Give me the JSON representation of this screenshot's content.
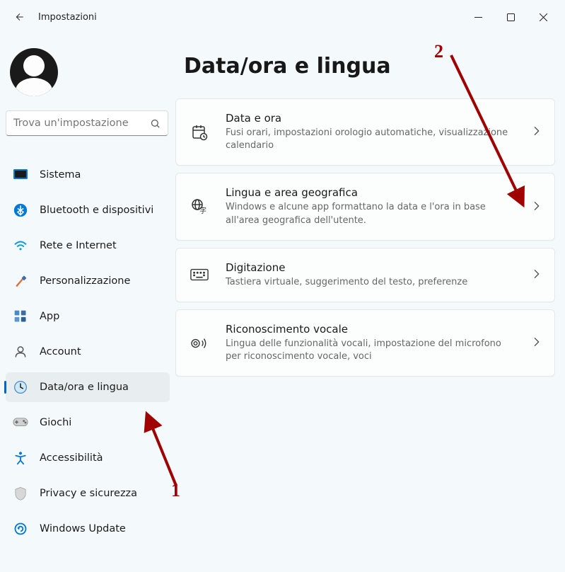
{
  "window": {
    "title": "Impostazioni"
  },
  "search": {
    "placeholder": "Trova un'impostazione"
  },
  "sidebar": {
    "items": [
      {
        "label": "Sistema",
        "icon": "system"
      },
      {
        "label": "Bluetooth e dispositivi",
        "icon": "bluetooth"
      },
      {
        "label": "Rete e Internet",
        "icon": "wifi"
      },
      {
        "label": "Personalizzazione",
        "icon": "brush"
      },
      {
        "label": "App",
        "icon": "apps"
      },
      {
        "label": "Account",
        "icon": "account"
      },
      {
        "label": "Data/ora e lingua",
        "icon": "clock"
      },
      {
        "label": "Giochi",
        "icon": "games"
      },
      {
        "label": "Accessibilità",
        "icon": "accessibility"
      },
      {
        "label": "Privacy e sicurezza",
        "icon": "privacy"
      },
      {
        "label": "Windows Update",
        "icon": "update"
      }
    ],
    "activeIndex": 6
  },
  "page": {
    "title": "Data/ora e lingua"
  },
  "cards": [
    {
      "title": "Data e ora",
      "desc": "Fusi orari, impostazioni orologio automatiche, visualizzazione calendario",
      "icon": "calendar"
    },
    {
      "title": "Lingua e area geografica",
      "desc": "Windows e alcune app formattano la data e l'ora in base all'area geografica dell'utente.",
      "icon": "language"
    },
    {
      "title": "Digitazione",
      "desc": "Tastiera virtuale, suggerimento del testo, preferenze",
      "icon": "keyboard"
    },
    {
      "title": "Riconoscimento vocale",
      "desc": "Lingua delle funzionalità vocali, impostazione del microfono per riconoscimento vocale, voci",
      "icon": "speech"
    }
  ],
  "annotations": {
    "label1": "1",
    "label2": "2"
  }
}
